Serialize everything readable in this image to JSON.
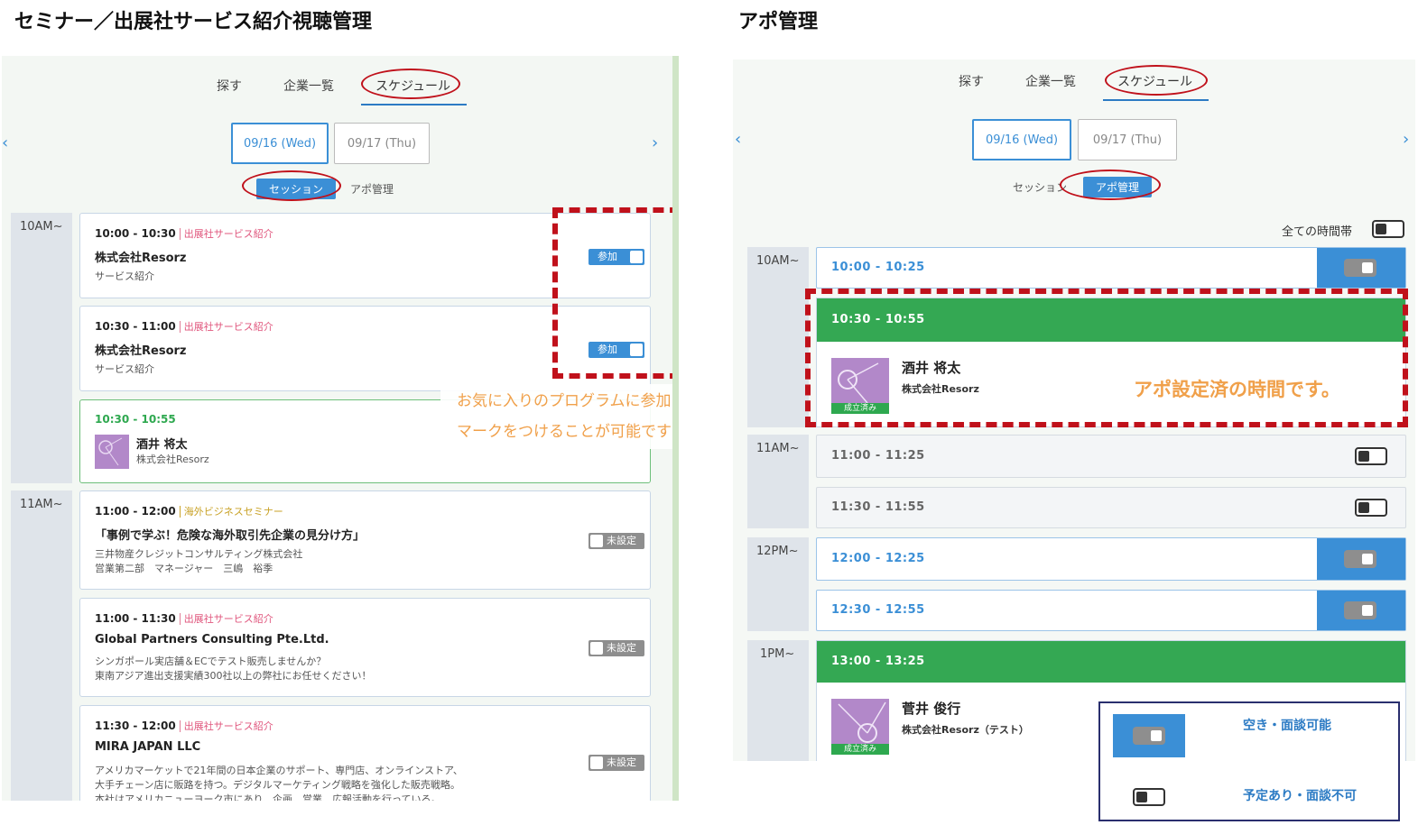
{
  "headings": {
    "left": "セミナー／出展社サービス紹介視聴管理",
    "right": "アポ管理"
  },
  "tabs": [
    "探す",
    "企業一覧",
    "スケジュール"
  ],
  "dates": [
    "09/16 (Wed)",
    "09/17 (Thu)"
  ],
  "subtabs": {
    "session": "セッション",
    "appo": "アポ管理"
  },
  "left": {
    "time_labels": [
      "10AM~",
      "11AM~"
    ],
    "cards": [
      {
        "time": "10:00 - 10:30",
        "type": "出展社サービス紹介",
        "title": "株式会社Resorz",
        "desc": "サービス紹介",
        "toggle": "参加"
      },
      {
        "time": "10:30 - 11:00",
        "type": "出展社サービス紹介",
        "title": "株式会社Resorz",
        "desc": "サービス紹介",
        "toggle": "参加"
      },
      {
        "time": "10:30 - 10:55",
        "name": "酒井 将太",
        "company": "株式会社Resorz"
      },
      {
        "time": "11:00 - 12:00",
        "type": "海外ビジネスセミナー",
        "title": "「事例で学ぶ！危険な海外取引先企業の見分け方」",
        "desc1": "三井物産クレジットコンサルティング株式会社",
        "desc2": "営業第二部　マネージャー　三嶋　裕季",
        "toggle": "未設定"
      },
      {
        "time": "11:00 - 11:30",
        "type": "出展社サービス紹介",
        "title": "Global Partners Consulting Pte.Ltd.",
        "desc1": "シンガポール実店舗＆ECでテスト販売しませんか？",
        "desc2": "東南アジア進出支援実績300社以上の弊社にお任せください！",
        "toggle": "未設定"
      },
      {
        "time": "11:30 - 12:00",
        "type": "出展社サービス紹介",
        "title": "MIRA JAPAN LLC",
        "desc1": "アメリカマーケットで21年間の日本企業のサポート、専門店、オンラインストア、",
        "desc2": "大手チェーン店に販路を持つ。デジタルマーケティング戦略を強化した販売戦略。",
        "desc3": "本社はアメリカニューヨーク市にあり、企画、営業、広報活動を行っている。",
        "toggle": "未設定"
      }
    ],
    "callout": [
      "お気に入りのプログラムに参加",
      "マークをつけることが可能です"
    ],
    "avatar_tag": ""
  },
  "right": {
    "all_time_label": "全ての時間帯",
    "time_labels": [
      "10AM~",
      "11AM~",
      "12PM~",
      "1PM~"
    ],
    "slots": [
      "10:00 - 10:25",
      "11:00 - 11:25",
      "11:30 - 11:55",
      "12:00 - 12:25",
      "12:30 - 12:55"
    ],
    "booked": [
      {
        "time": "10:30 - 10:55",
        "name": "酒井 将太",
        "company": "株式会社Resorz"
      },
      {
        "time": "13:00 - 13:25",
        "name": "菅井 俊行",
        "company": "株式会社Resorz（テスト）"
      }
    ],
    "avatar_tag": "成立済み",
    "callout": "アポ設定済の時間です。",
    "legend": {
      "available": "空き・面談可能",
      "busy": "予定あり・面談不可"
    }
  },
  "colors": {
    "accent": "#3b8fd6",
    "booked": "#34a853",
    "annotation": "#c0111b",
    "callout": "#f0a04a"
  }
}
